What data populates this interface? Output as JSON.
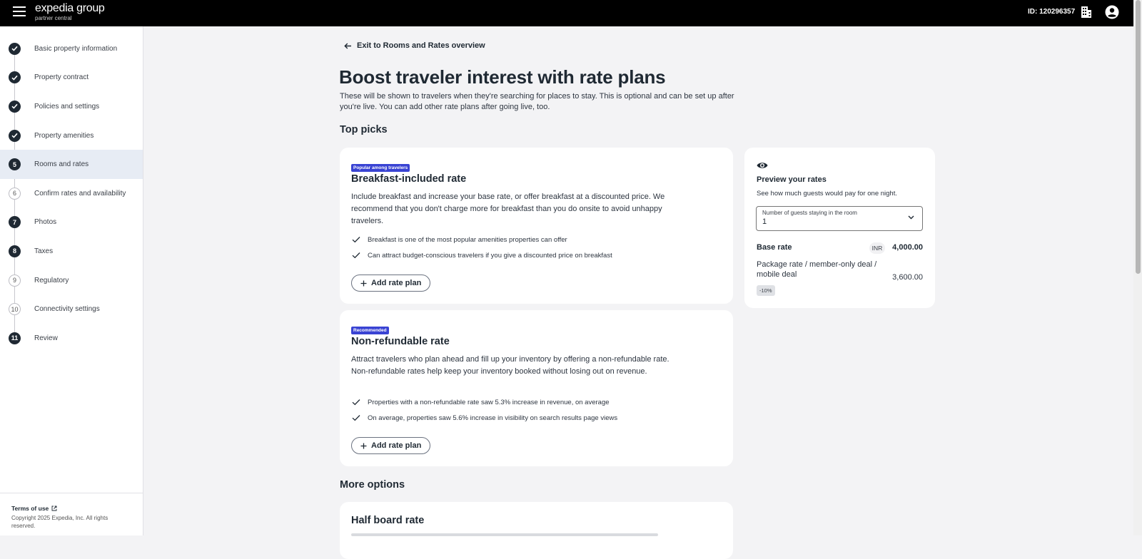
{
  "topbar": {
    "brand_name": "expedia group",
    "brand_sub": "partner central",
    "property_id": "ID: 120296357"
  },
  "sidebar": {
    "steps": [
      {
        "marker": "",
        "label": "Basic property information",
        "state": "done"
      },
      {
        "marker": "",
        "label": "Property contract",
        "state": "done"
      },
      {
        "marker": "",
        "label": "Policies and settings",
        "state": "done"
      },
      {
        "marker": "",
        "label": "Property amenities",
        "state": "done"
      },
      {
        "marker": "5",
        "label": "Rooms and rates",
        "state": "current"
      },
      {
        "marker": "6",
        "label": "Confirm rates and availability",
        "state": "outline"
      },
      {
        "marker": "7",
        "label": "Photos",
        "state": "filled"
      },
      {
        "marker": "8",
        "label": "Taxes",
        "state": "filled"
      },
      {
        "marker": "9",
        "label": "Regulatory",
        "state": "outline"
      },
      {
        "marker": "10",
        "label": "Connectivity settings",
        "state": "outline"
      },
      {
        "marker": "11",
        "label": "Review",
        "state": "filled"
      }
    ],
    "footer": {
      "terms": "Terms of use",
      "copyright": "Copyright 2025 Expedia, Inc. All rights reserved."
    }
  },
  "main": {
    "exit_link": "Exit to Rooms and Rates overview",
    "title": "Boost traveler interest with rate plans",
    "description": "These will be shown to travelers when they're searching for places to stay. This is optional and can be set up after you're live. You can add other rate plans after going live, too.",
    "top_picks_title": "Top picks",
    "more_options_title": "More options",
    "cards": [
      {
        "badge": "Popular among travelers",
        "title": "Breakfast-included rate",
        "description": "Include breakfast and increase your base rate, or offer breakfast at a discounted price. We recommend that you don't charge more for breakfast than you do onsite to avoid unhappy travelers.",
        "benefits": [
          "Breakfast is one of the most popular amenities properties can offer",
          "Can attract budget-conscious travelers if you give a discounted price on breakfast"
        ],
        "button": "Add rate plan"
      },
      {
        "badge": "Recommended",
        "title": "Non-refundable rate",
        "description": "Attract travelers who plan ahead and fill up your inventory by offering a non-refundable rate. Non-refundable rates help keep your inventory booked without losing out on revenue.",
        "benefits": [
          "Properties with a non-refundable rate saw 5.3% increase in revenue, on average",
          "On average, properties saw 5.6% increase in visibility on search results page views"
        ],
        "button": "Add rate plan"
      },
      {
        "title": "Half board rate"
      }
    ]
  },
  "preview": {
    "title": "Preview your rates",
    "subtitle": "See how much guests would pay for one night.",
    "guests_label": "Number of guests staying in the room",
    "guests_value": "1",
    "base_label": "Base rate",
    "currency": "INR",
    "base_value": "4,000.00",
    "package_label": "Package rate / member-only deal / mobile deal",
    "package_value": "3,600.00",
    "discount": "-10%"
  },
  "colors": {
    "badge": "#3943d3",
    "topbar": "#000000",
    "active_step": "#e7ecf4"
  }
}
